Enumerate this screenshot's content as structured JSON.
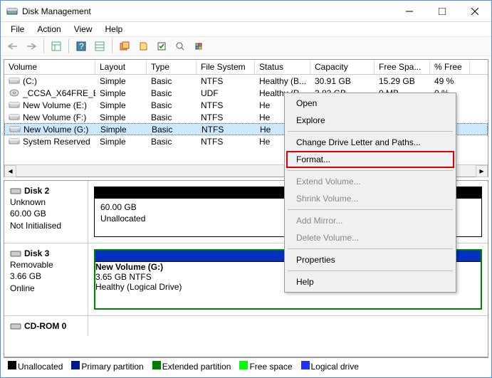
{
  "title": "Disk Management",
  "menu": [
    "File",
    "Action",
    "View",
    "Help"
  ],
  "columns": [
    "Volume",
    "Layout",
    "Type",
    "File System",
    "Status",
    "Capacity",
    "Free Spa...",
    "% Free"
  ],
  "rows": [
    {
      "icon": "drive",
      "vol": " (C:)",
      "layout": "Simple",
      "type": "Basic",
      "fs": "NTFS",
      "st": "Healthy (B...",
      "cap": "30.91 GB",
      "free": "15.29 GB",
      "pct": "49 %"
    },
    {
      "icon": "cd",
      "vol": "_CCSA_X64FRE_E...",
      "layout": "Simple",
      "type": "Basic",
      "fs": "UDF",
      "st": "Healthy (P...",
      "cap": "3.82 GB",
      "free": "0 MB",
      "pct": "0 %"
    },
    {
      "icon": "drive",
      "vol": "New Volume (E:)",
      "layout": "Simple",
      "type": "Basic",
      "fs": "NTFS",
      "st": "He",
      "cap": "",
      "free": "",
      "pct": ""
    },
    {
      "icon": "drive",
      "vol": "New Volume (F:)",
      "layout": "Simple",
      "type": "Basic",
      "fs": "NTFS",
      "st": "He",
      "cap": "",
      "free": "",
      "pct": ""
    },
    {
      "icon": "drive",
      "vol": "New Volume (G:)",
      "layout": "Simple",
      "type": "Basic",
      "fs": "NTFS",
      "st": "He",
      "cap": "",
      "free": "",
      "pct": "",
      "sel": true
    },
    {
      "icon": "drive",
      "vol": "System Reserved",
      "layout": "Simple",
      "type": "Basic",
      "fs": "NTFS",
      "st": "He",
      "cap": "",
      "free": "",
      "pct": ""
    }
  ],
  "disks": [
    {
      "name": "Disk 2",
      "lines": [
        "Unknown",
        "60.00 GB",
        "Not Initialised"
      ],
      "stripe": "#000",
      "plines": [
        "60.00 GB",
        "Unallocated"
      ]
    },
    {
      "name": "Disk 3",
      "lines": [
        "Removable",
        "3.66 GB",
        "Online"
      ],
      "stripe": "#0030c0",
      "pbold": "New Volume  (G:)",
      "plines": [
        "3.65 GB NTFS",
        "Healthy (Logical Drive)"
      ],
      "hatched": true
    },
    {
      "name": "CD-ROM 0",
      "lines": [],
      "cut": true
    }
  ],
  "legend": [
    {
      "c": "#000",
      "t": "Unallocated"
    },
    {
      "c": "#00178f",
      "t": "Primary partition"
    },
    {
      "c": "#008000",
      "t": "Extended partition"
    },
    {
      "c": "#00ff00",
      "t": "Free space"
    },
    {
      "c": "#2030ff",
      "t": "Logical drive"
    }
  ],
  "ctx": [
    {
      "t": "Open"
    },
    {
      "t": "Explore"
    },
    {
      "sep": true
    },
    {
      "t": "Change Drive Letter and Paths..."
    },
    {
      "t": "Format...",
      "hl": true
    },
    {
      "sep": true
    },
    {
      "t": "Extend Volume...",
      "d": true
    },
    {
      "t": "Shrink Volume...",
      "d": true
    },
    {
      "sep": true
    },
    {
      "t": "Add Mirror...",
      "d": true
    },
    {
      "t": "Delete Volume...",
      "d": true
    },
    {
      "sep": true
    },
    {
      "t": "Properties"
    },
    {
      "sep": true
    },
    {
      "t": "Help"
    }
  ]
}
